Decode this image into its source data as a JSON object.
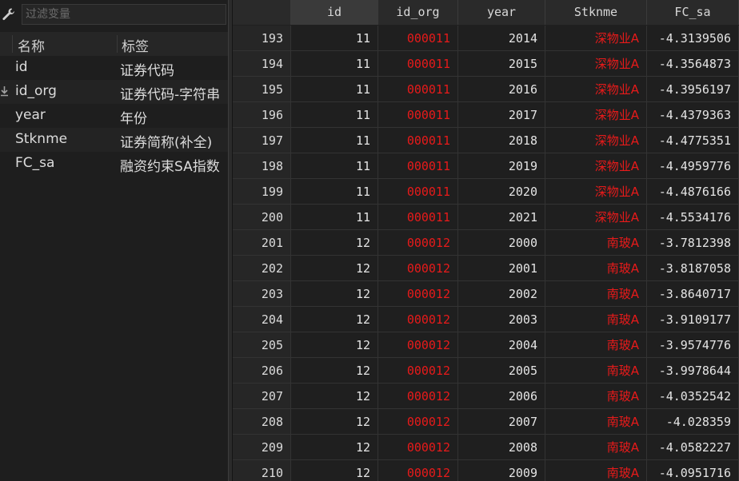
{
  "filter": {
    "placeholder": "过滤变量",
    "icon": "wrench-icon"
  },
  "variables": {
    "headers": {
      "name": "名称",
      "label": "标签"
    },
    "rows": [
      {
        "name": "id",
        "label": "证券代码",
        "key": false
      },
      {
        "name": "id_org",
        "label": "证券代码-字符串",
        "key": true
      },
      {
        "name": "year",
        "label": "年份",
        "key": false
      },
      {
        "name": "Stknme",
        "label": "证券简称(补全)",
        "key": false
      },
      {
        "name": "FC_sa",
        "label": "融资约束SA指数",
        "key": false
      }
    ]
  },
  "grid": {
    "columns": [
      "",
      "id",
      "id_org",
      "year",
      "Stknme",
      "FC_sa"
    ],
    "text_color_red": "#e81a1a",
    "rows": [
      [
        "193",
        "11",
        "000011",
        "2014",
        "深物业A",
        "-4.3139506"
      ],
      [
        "194",
        "11",
        "000011",
        "2015",
        "深物业A",
        "-4.3564873"
      ],
      [
        "195",
        "11",
        "000011",
        "2016",
        "深物业A",
        "-4.3956197"
      ],
      [
        "196",
        "11",
        "000011",
        "2017",
        "深物业A",
        "-4.4379363"
      ],
      [
        "197",
        "11",
        "000011",
        "2018",
        "深物业A",
        "-4.4775351"
      ],
      [
        "198",
        "11",
        "000011",
        "2019",
        "深物业A",
        "-4.4959776"
      ],
      [
        "199",
        "11",
        "000011",
        "2020",
        "深物业A",
        "-4.4876166"
      ],
      [
        "200",
        "11",
        "000011",
        "2021",
        "深物业A",
        "-4.5534176"
      ],
      [
        "201",
        "12",
        "000012",
        "2000",
        "南玻A",
        "-3.7812398"
      ],
      [
        "202",
        "12",
        "000012",
        "2001",
        "南玻A",
        "-3.8187058"
      ],
      [
        "203",
        "12",
        "000012",
        "2002",
        "南玻A",
        "-3.8640717"
      ],
      [
        "204",
        "12",
        "000012",
        "2003",
        "南玻A",
        "-3.9109177"
      ],
      [
        "205",
        "12",
        "000012",
        "2004",
        "南玻A",
        "-3.9574776"
      ],
      [
        "206",
        "12",
        "000012",
        "2005",
        "南玻A",
        "-3.9978644"
      ],
      [
        "207",
        "12",
        "000012",
        "2006",
        "南玻A",
        "-4.0352542"
      ],
      [
        "208",
        "12",
        "000012",
        "2007",
        "南玻A",
        "-4.028359"
      ],
      [
        "209",
        "12",
        "000012",
        "2008",
        "南玻A",
        "-4.0582227"
      ],
      [
        "210",
        "12",
        "000012",
        "2009",
        "南玻A",
        "-4.0951716"
      ]
    ]
  }
}
